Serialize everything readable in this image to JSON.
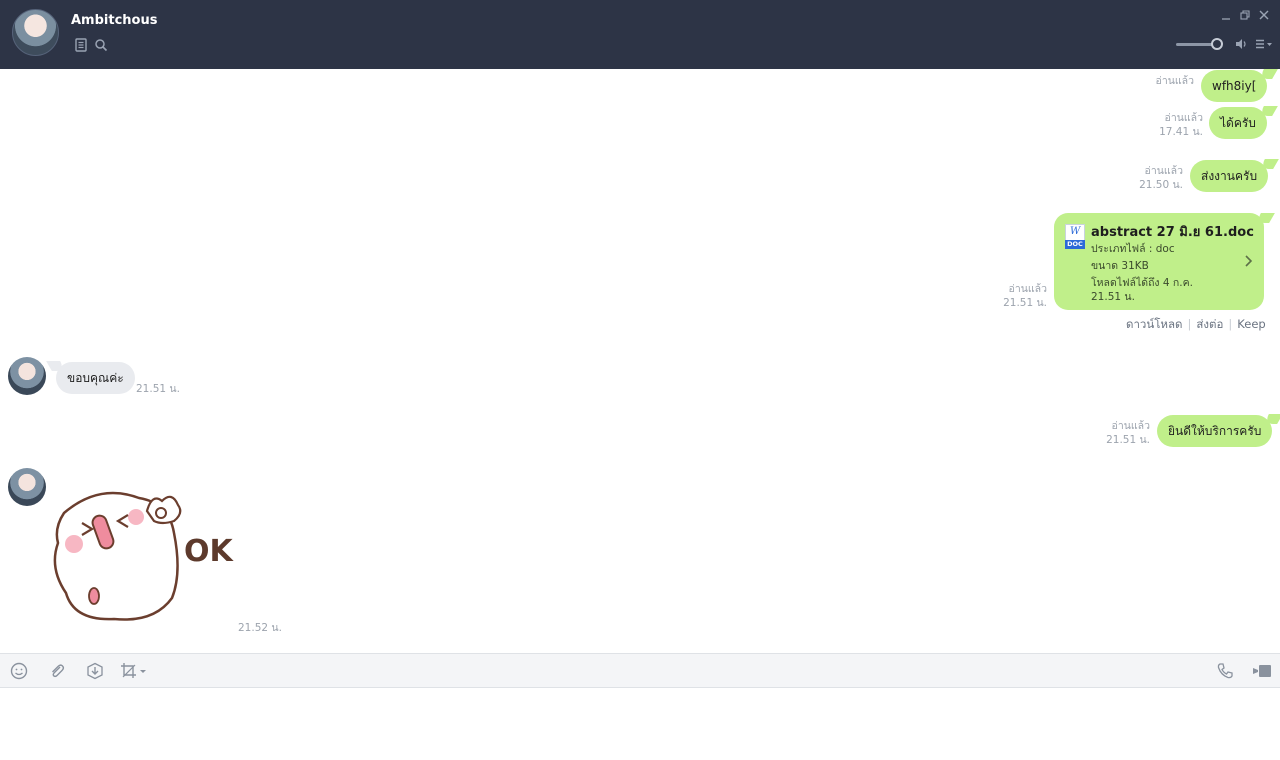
{
  "header": {
    "contact_name": "Ambitchous",
    "icons": {
      "notes": "note-icon",
      "search": "search-icon",
      "minimize": "minimize-icon",
      "restore": "restore-icon",
      "close": "close-icon",
      "volume": "speaker-icon",
      "menu": "menu-icon"
    },
    "volume_level": 0.9
  },
  "messages": {
    "m1": {
      "text": "wfh8iy[",
      "read": "อ่านแล้ว"
    },
    "m2": {
      "text": "ได้ครับ",
      "read": "อ่านแล้ว",
      "time": "17.41 น."
    },
    "m3": {
      "text": "ส่งงานครับ",
      "read": "อ่านแล้ว",
      "time": "21.50 น."
    },
    "file": {
      "name": "abstract 27 มิ.ย 61.doc",
      "type_line": "ประเภทไฟล์ : doc",
      "size_line": "ขนาด 31KB",
      "expiry_line1": "โหลดไฟล์ได้ถึง 4 ก.ค.",
      "expiry_line2": "21.51 น.",
      "icon_letter": "W",
      "icon_tag": "DOC",
      "read": "อ่านแล้ว",
      "time": "21.51 น.",
      "actions": {
        "download": "ดาวน์โหลด",
        "forward": "ส่งต่อ",
        "keep": "Keep"
      }
    },
    "m4": {
      "text": "ขอบคุณค่ะ",
      "time": "21.51 น."
    },
    "m5": {
      "text": "ยินดีให้บริการครับ",
      "read": "อ่านแล้ว",
      "time": "21.51 น."
    },
    "sticker": {
      "label": "OK",
      "time": "21.52 น."
    }
  },
  "toolbar": {
    "icons": [
      "emoji-icon",
      "attachment-icon",
      "download-icon",
      "screenshot-crop-icon",
      "phone-call-icon",
      "video-call-icon"
    ]
  },
  "colors": {
    "header_bg": "#2d3446",
    "bubble_out": "#c0ef8a",
    "bubble_in": "#e9ebef",
    "meta_text": "#9ca3ad"
  }
}
